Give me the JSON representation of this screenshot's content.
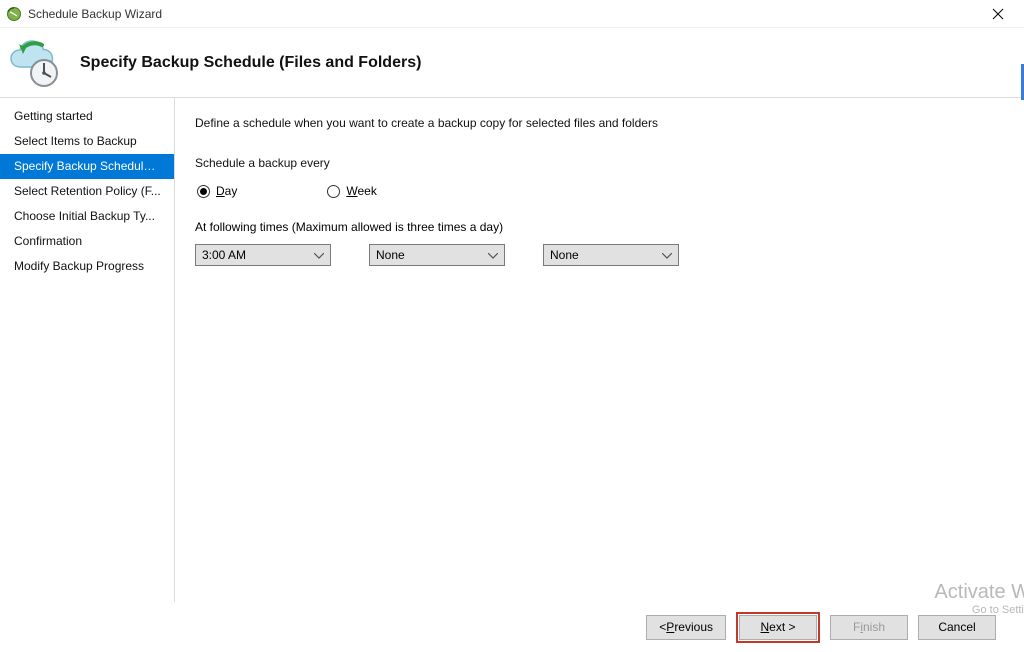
{
  "titlebar": {
    "title": "Schedule Backup Wizard"
  },
  "banner": {
    "heading": "Specify Backup Schedule (Files and Folders)"
  },
  "sidebar": {
    "items": [
      {
        "label": "Getting started"
      },
      {
        "label": "Select Items to Backup"
      },
      {
        "label": "Specify Backup Schedule ..."
      },
      {
        "label": "Select Retention Policy (F..."
      },
      {
        "label": "Choose Initial Backup Ty..."
      },
      {
        "label": "Confirmation"
      },
      {
        "label": "Modify Backup Progress"
      }
    ]
  },
  "content": {
    "description": "Define a schedule when you want to create a backup copy for selected files and folders",
    "schedule_every_label": "Schedule a backup every",
    "radios": {
      "day_prefix": "D",
      "day_rest": "ay",
      "week_prefix": "W",
      "week_rest": "eek"
    },
    "times_label": "At following times (Maximum allowed is three times a day)",
    "time_selects": [
      "3:00 AM",
      "None",
      "None"
    ]
  },
  "footer": {
    "previous_prefix": "< ",
    "previous_hk": "P",
    "previous_rest": "revious",
    "next_hk": "N",
    "next_rest": "ext >",
    "finish_prefix": "F",
    "finish_hk": "i",
    "finish_rest": "nish",
    "cancel": "Cancel"
  },
  "watermark": {
    "line1": "Activate W",
    "line2": "Go to Settin"
  }
}
